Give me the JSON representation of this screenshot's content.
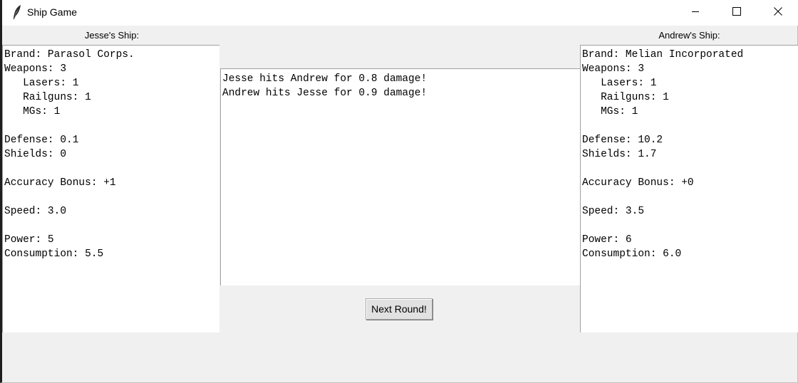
{
  "window": {
    "title": "Ship Game",
    "icon": "feather-icon",
    "controls": [
      "minimize-icon",
      "maximize-icon",
      "close-icon"
    ]
  },
  "jesse": {
    "label": "Jesse's Ship:",
    "stats": "Brand: Parasol Corps.\nWeapons: 3\n   Lasers: 1\n   Railguns: 1\n   MGs: 1\n\nDefense: 0.1\nShields: 0\n\nAccuracy Bonus: +1\n\nSpeed: 3.0\n\nPower: 5\nConsumption: 5.5"
  },
  "andrew": {
    "label": "Andrew's Ship:",
    "stats": "Brand: Melian Incorporated\nWeapons: 3\n   Lasers: 1\n   Railguns: 1\n   MGs: 1\n\nDefense: 10.2\nShields: 1.7\n\nAccuracy Bonus: +0\n\nSpeed: 3.5\n\nPower: 6\nConsumption: 6.0"
  },
  "log": {
    "text": "Jesse hits Andrew for 0.8 damage!\nAndrew hits Jesse for 0.9 damage!"
  },
  "next_button": {
    "label": "Next Round!"
  }
}
